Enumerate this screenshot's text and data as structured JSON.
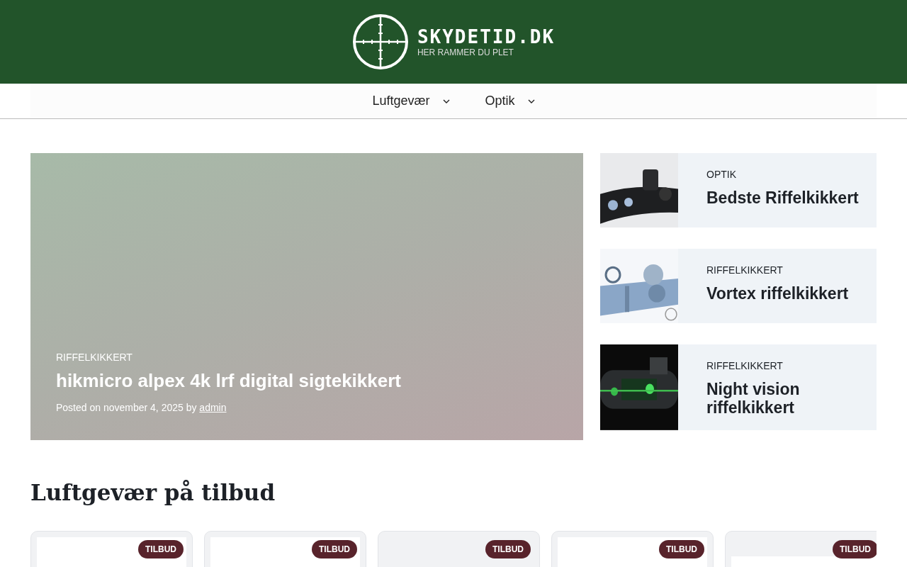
{
  "header": {
    "logo_title": "SKYDETID.DK",
    "logo_tagline": "HER RAMMER DU PLET"
  },
  "nav": {
    "items": [
      {
        "label": "Luftgevær",
        "has_dropdown": true
      },
      {
        "label": "Optik",
        "has_dropdown": true
      }
    ]
  },
  "featured": {
    "category": "RIFFELKIKKERT",
    "title": "hikmicro alpex 4k lrf digital sigtekikkert",
    "meta_prefix": "Posted on november 4, 2025 by",
    "author": "admin"
  },
  "side_posts": [
    {
      "category": "OPTIK",
      "title": "Bedste Riffelkikkert"
    },
    {
      "category": "RIFFELKIKKERT",
      "title": "Vortex riffelkikkert"
    },
    {
      "category": "RIFFELKIKKERT",
      "title": "Night vision riffelkikkert"
    }
  ],
  "section_title": "Luftgevær på tilbud",
  "products": [
    {
      "badge": "TILBUD",
      "framed": true
    },
    {
      "badge": "TILBUD",
      "framed": true
    },
    {
      "badge": "TILBUD",
      "framed": false
    },
    {
      "badge": "TILBUD",
      "framed": true
    },
    {
      "badge": "TILBUD",
      "framed": true
    }
  ]
}
